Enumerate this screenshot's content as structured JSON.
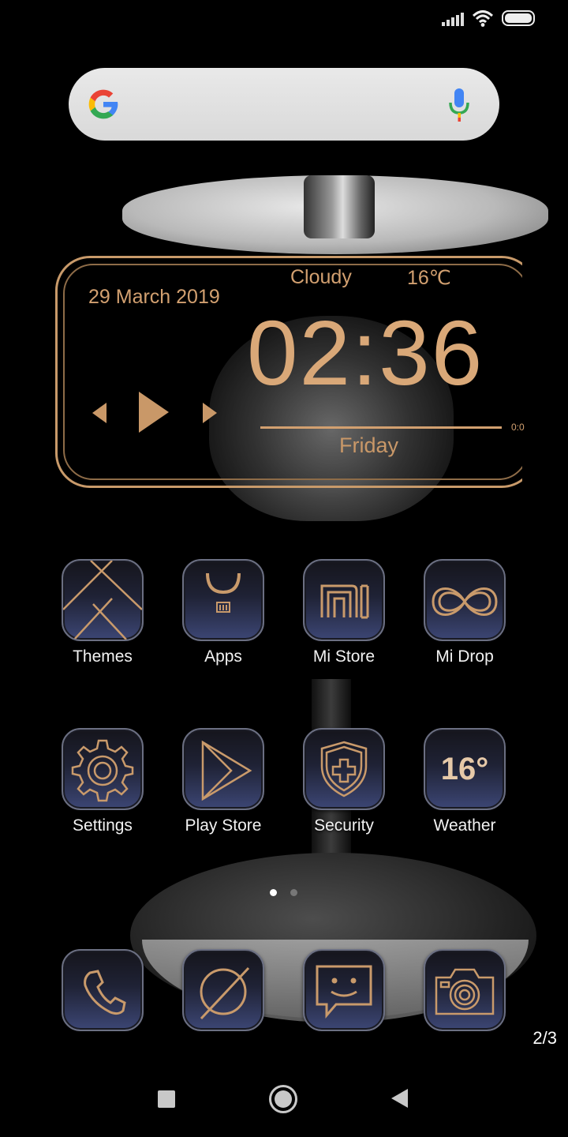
{
  "status_bar": {
    "icons": [
      "signal-icon",
      "wifi-icon",
      "battery-icon"
    ]
  },
  "search": {
    "logo": "google-logo",
    "mic": "mic-icon"
  },
  "widget": {
    "date": "29 March 2019",
    "weather_condition": "Cloudy",
    "temperature": "16℃",
    "time": "02:36",
    "day": "Friday",
    "media_progress_label": "0:0",
    "accent_color": "#d2a070"
  },
  "apps_row1": [
    {
      "label": "Themes",
      "icon": "themes-icon"
    },
    {
      "label": "Apps",
      "icon": "apps-icon"
    },
    {
      "label": "Mi Store",
      "icon": "mi-store-icon"
    },
    {
      "label": "Mi Drop",
      "icon": "mi-drop-icon"
    }
  ],
  "apps_row2": [
    {
      "label": "Settings",
      "icon": "gear-icon"
    },
    {
      "label": "Play Store",
      "icon": "play-store-icon"
    },
    {
      "label": "Security",
      "icon": "shield-icon"
    },
    {
      "label": "Weather",
      "icon": "weather-icon",
      "icon_text": "16°"
    }
  ],
  "dock": [
    {
      "icon": "phone-icon"
    },
    {
      "icon": "browser-icon"
    },
    {
      "icon": "messaging-icon"
    },
    {
      "icon": "camera-icon"
    }
  ],
  "page_indicator": {
    "current_page": 1,
    "total_pages": 2
  },
  "page_counter": "2/3",
  "nav": [
    "recent-apps-button",
    "home-button",
    "back-button"
  ]
}
